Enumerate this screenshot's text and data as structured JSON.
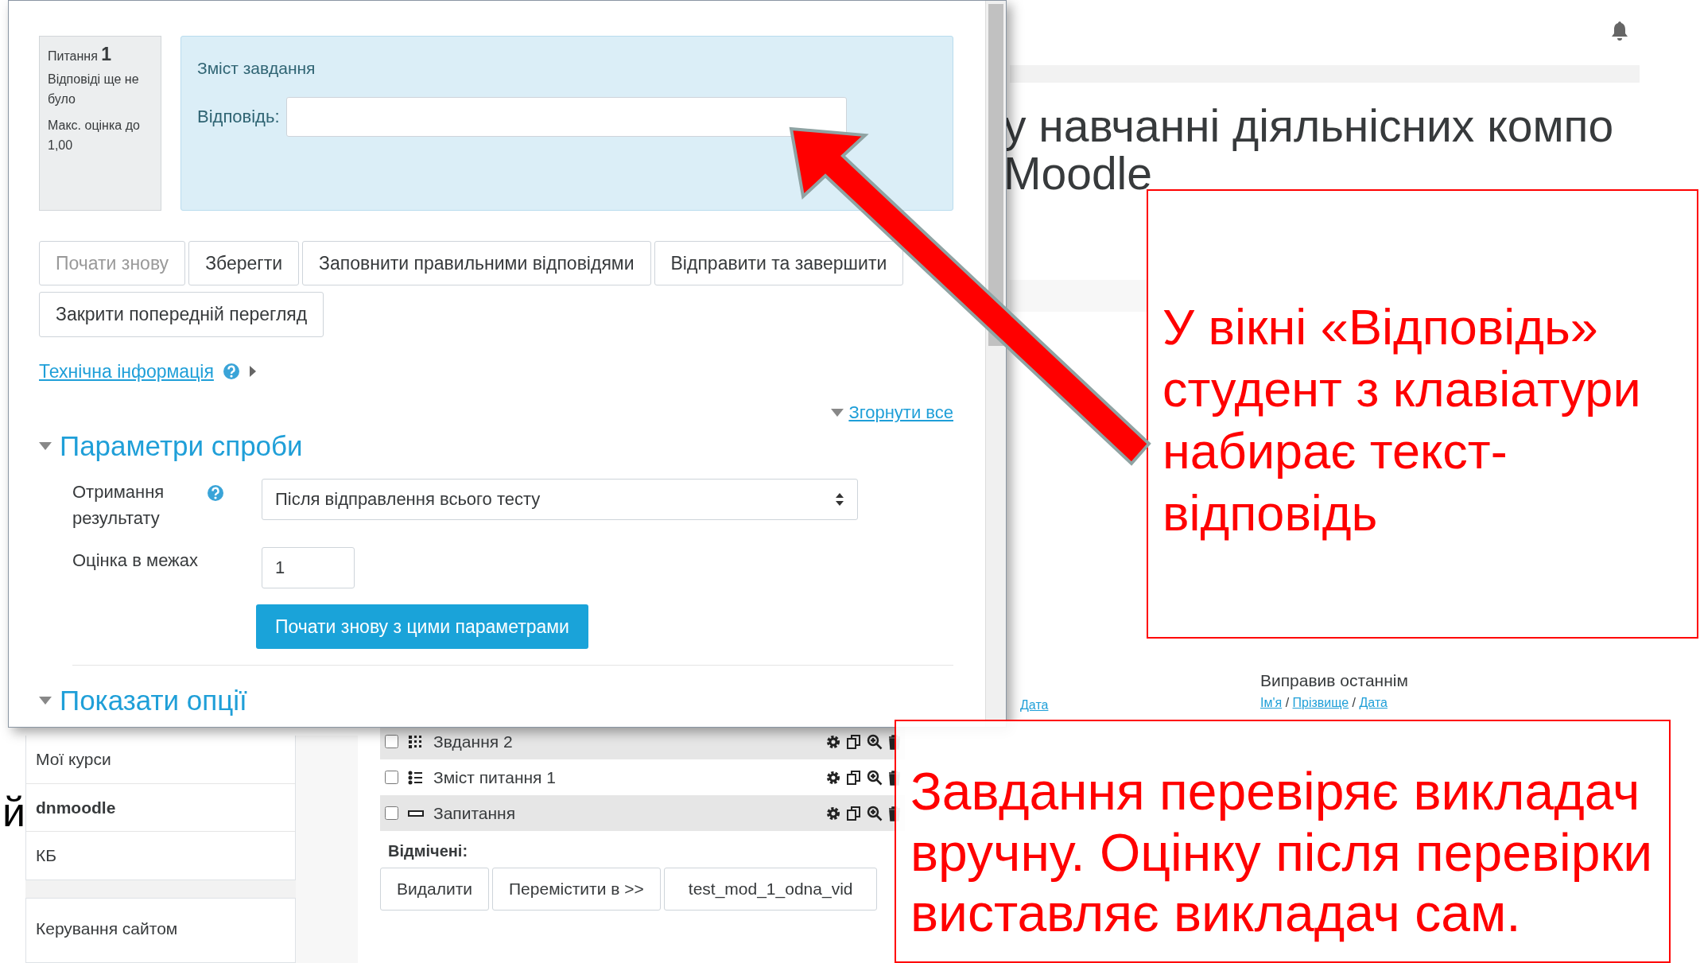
{
  "background_page": {
    "page_title_lines": [
      "у навчанні діяльнісних компо",
      "Moodle"
    ],
    "sidebar": [
      {
        "label": "Мої курси",
        "bold": false
      },
      {
        "label": "dnmoodle",
        "bold": true
      },
      {
        "label": "КБ",
        "bold": false
      }
    ],
    "site_admin": "Керування сайтом",
    "questions": [
      {
        "name": "Звдання 2",
        "kind": "matching",
        "checked": false
      },
      {
        "name": "Зміст питання 1",
        "kind": "list",
        "checked": false
      },
      {
        "name": "Запитання",
        "kind": "short",
        "checked": false
      }
    ],
    "selected_label": "Відмічені:",
    "actions": [
      "Видалити",
      "Перемістити в >>"
    ],
    "category_select": "test_mod_1_odna_vid",
    "date_link": "Дата",
    "last_edited": {
      "title": "Виправив останнім",
      "links": [
        "Ім'я",
        "Прізвище",
        "Дата"
      ],
      "separator": "/"
    }
  },
  "preview_window": {
    "question": {
      "label": "Питання",
      "number": "1",
      "status": "Відповіді ще не було",
      "max_grade": "Макс. оцінка до 1,00"
    },
    "content_title": "Зміст завдання",
    "answer_label": "Відповідь:",
    "buttons": [
      {
        "label": "Почати знову",
        "disabled": true
      },
      {
        "label": "Зберегти",
        "disabled": false
      },
      {
        "label": "Заповнити правильними відповідями",
        "disabled": false
      },
      {
        "label": "Відправити та завершити",
        "disabled": false
      },
      {
        "label": "Закрити попередній перегляд",
        "disabled": false
      }
    ],
    "tech_info": "Технічна інформація",
    "collapse_all": "Згорнути все",
    "attempt_params": {
      "title": "Параметри спроби",
      "fields": [
        {
          "kind": "select",
          "label": "Отримання результату",
          "value": "Після відправлення всього тесту",
          "help": true
        },
        {
          "kind": "text",
          "label": "Оцінка в межах",
          "value": "1",
          "help": false
        }
      ],
      "submit": "Почати знову з цими параметрами"
    },
    "show_options": "Показати опції"
  },
  "slide_fragment": "й",
  "callouts": [
    "У вікні «Відповідь» студент з клавіатури набирає текст-відповідь",
    "Завдання перевіряє викладач вручну. Оцінку після перевірки виставляє викладач сам."
  ]
}
